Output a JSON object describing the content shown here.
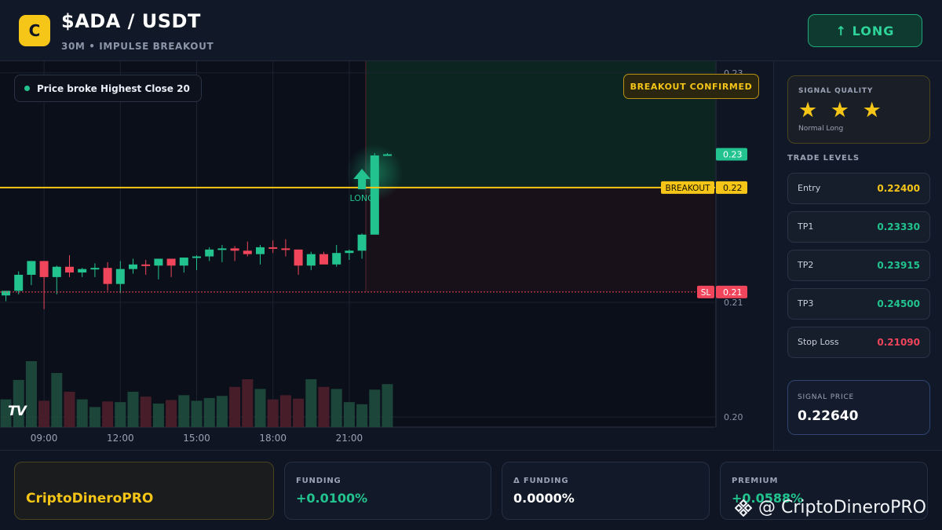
{
  "header": {
    "coin_logo": "C",
    "pair_title": "$ADA / USDT",
    "pair_sub": "30M • IMPULSE BREAKOUT",
    "long_button": "↑ LONG"
  },
  "chart": {
    "legend": "Price broke Highest Close 20",
    "breakout_confirmed": "BREAKOUT CONFIRMED",
    "tv_logo": "TV"
  },
  "chart_data": {
    "type": "candlestick",
    "x_ticks": [
      {
        "label": "09:00",
        "index": 3
      },
      {
        "label": "12:00",
        "index": 9
      },
      {
        "label": "15:00",
        "index": 15
      },
      {
        "label": "18:00",
        "index": 21
      },
      {
        "label": "21:00",
        "index": 27
      }
    ],
    "y_ticks": [
      0.23,
      0.22,
      0.21,
      0.2
    ],
    "ylim": [
      0.1996,
      0.2306
    ],
    "candles": [
      {
        "o": 0.2106,
        "h": 0.2109,
        "l": 0.2101,
        "c": 0.211
      },
      {
        "o": 0.211,
        "h": 0.2127,
        "l": 0.2107,
        "c": 0.2124
      },
      {
        "o": 0.2124,
        "h": 0.2134,
        "l": 0.2115,
        "c": 0.2136
      },
      {
        "o": 0.2136,
        "h": 0.2136,
        "l": 0.2094,
        "c": 0.2122
      },
      {
        "o": 0.2122,
        "h": 0.2132,
        "l": 0.2107,
        "c": 0.2131
      },
      {
        "o": 0.2131,
        "h": 0.2141,
        "l": 0.2122,
        "c": 0.2126
      },
      {
        "o": 0.2126,
        "h": 0.213,
        "l": 0.2122,
        "c": 0.2129
      },
      {
        "o": 0.2129,
        "h": 0.2134,
        "l": 0.2122,
        "c": 0.213
      },
      {
        "o": 0.213,
        "h": 0.2135,
        "l": 0.211,
        "c": 0.2116
      },
      {
        "o": 0.2116,
        "h": 0.2136,
        "l": 0.2108,
        "c": 0.2129
      },
      {
        "o": 0.2129,
        "h": 0.2138,
        "l": 0.2125,
        "c": 0.2133
      },
      {
        "o": 0.2133,
        "h": 0.2137,
        "l": 0.2124,
        "c": 0.2132
      },
      {
        "o": 0.2132,
        "h": 0.2138,
        "l": 0.212,
        "c": 0.2138
      },
      {
        "o": 0.2138,
        "h": 0.2138,
        "l": 0.2122,
        "c": 0.2132
      },
      {
        "o": 0.2132,
        "h": 0.2138,
        "l": 0.2126,
        "c": 0.2139
      },
      {
        "o": 0.2139,
        "h": 0.2141,
        "l": 0.2128,
        "c": 0.214
      },
      {
        "o": 0.214,
        "h": 0.2148,
        "l": 0.2136,
        "c": 0.2146
      },
      {
        "o": 0.2146,
        "h": 0.215,
        "l": 0.2135,
        "c": 0.2147
      },
      {
        "o": 0.2147,
        "h": 0.2149,
        "l": 0.2136,
        "c": 0.2145
      },
      {
        "o": 0.2145,
        "h": 0.2153,
        "l": 0.214,
        "c": 0.2142
      },
      {
        "o": 0.2142,
        "h": 0.215,
        "l": 0.2133,
        "c": 0.2148
      },
      {
        "o": 0.2148,
        "h": 0.2154,
        "l": 0.2143,
        "c": 0.2147
      },
      {
        "o": 0.2147,
        "h": 0.2155,
        "l": 0.214,
        "c": 0.2146
      },
      {
        "o": 0.2146,
        "h": 0.2146,
        "l": 0.2124,
        "c": 0.2132
      },
      {
        "o": 0.2132,
        "h": 0.2144,
        "l": 0.2128,
        "c": 0.2142
      },
      {
        "o": 0.2142,
        "h": 0.2144,
        "l": 0.2133,
        "c": 0.2133
      },
      {
        "o": 0.2133,
        "h": 0.215,
        "l": 0.2131,
        "c": 0.2143
      },
      {
        "o": 0.2143,
        "h": 0.2146,
        "l": 0.2137,
        "c": 0.2145
      },
      {
        "o": 0.2145,
        "h": 0.216,
        "l": 0.2138,
        "c": 0.2159
      },
      {
        "o": 0.2159,
        "h": 0.223,
        "l": 0.2159,
        "c": 0.2228
      },
      {
        "o": 0.2228,
        "h": 0.223,
        "l": 0.2228,
        "c": 0.2229
      }
    ],
    "volumes": [
      40,
      68,
      95,
      38,
      78,
      51,
      40,
      29,
      37,
      36,
      51,
      44,
      34,
      39,
      46,
      38,
      42,
      45,
      58,
      69,
      55,
      40,
      46,
      41,
      69,
      58,
      55,
      36,
      33,
      54,
      62
    ],
    "breakout_level": 0.22,
    "stop_level": 0.2109,
    "price_tags": [
      {
        "label": "BREAKOUT",
        "value": "0.22",
        "level": 0.22
      },
      {
        "label": "SL",
        "value": "0.21",
        "level": 0.2109
      },
      {
        "label": "",
        "value": "0.23",
        "level": 0.2229
      }
    ],
    "long_marker": {
      "label": "LONG",
      "index": 28
    },
    "colors": {
      "up": "#22c38e",
      "down": "#f0455a",
      "breakout": "#f5c518",
      "stop": "#f0455a"
    }
  },
  "sidebar": {
    "quality_label": "SIGNAL QUALITY",
    "stars": "★ ★ ★",
    "quality_sub": "Normal Long",
    "levels_title": "TRADE LEVELS",
    "levels": [
      {
        "name": "Entry",
        "value": "0.22400",
        "color": "#f5c518"
      },
      {
        "name": "TP1",
        "value": "0.23330",
        "color": "#22c38e"
      },
      {
        "name": "TP2",
        "value": "0.23915",
        "color": "#22c38e"
      },
      {
        "name": "TP3",
        "value": "0.24500",
        "color": "#22c38e"
      },
      {
        "name": "Stop Loss",
        "value": "0.21090",
        "color": "#f0455a"
      }
    ],
    "signal_label": "SIGNAL PRICE",
    "signal_value": "0.22640"
  },
  "footer": {
    "brand": "CriptoDineroPRO",
    "stats": [
      {
        "label": "FUNDING",
        "value": "+0.0100%",
        "color": "#22c38e"
      },
      {
        "label": "Δ FUNDING",
        "value": "0.0000%",
        "color": "#ffffff"
      },
      {
        "label": "PREMIUM",
        "value": "+0.0588%",
        "color": "#22c38e"
      }
    ],
    "watermark": "@ CriptoDineroPRO"
  }
}
